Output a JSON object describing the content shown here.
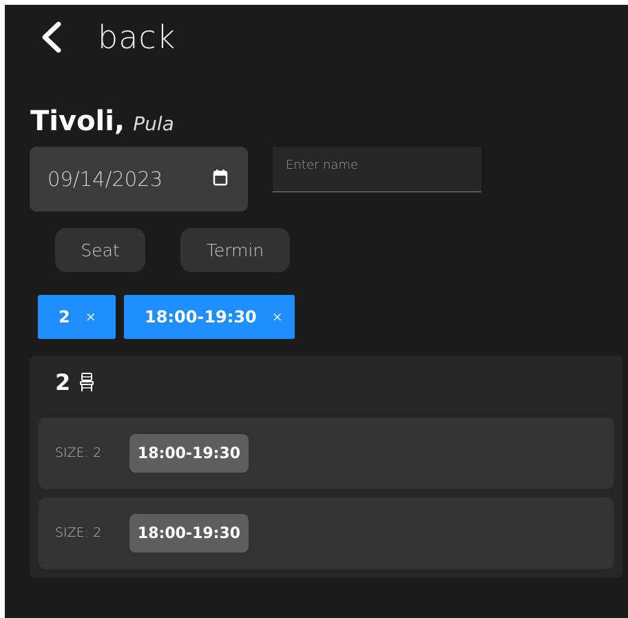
{
  "header": {
    "back_label": "back"
  },
  "venue": {
    "name": "Tivoli",
    "comma": ",",
    "city": "Pula"
  },
  "form": {
    "date_value": "09/14/2023",
    "name_placeholder": "Enter name",
    "name_value": ""
  },
  "filters": {
    "seat_label": "Seat",
    "termin_label": "Termin"
  },
  "active_filters": [
    {
      "label": "2",
      "close": "×"
    },
    {
      "label": "18:00-19:30",
      "close": "×"
    }
  ],
  "results": {
    "seat_count": "2",
    "icons": {
      "back": "chevron-left-icon",
      "calendar": "calendar-icon",
      "seat": "chair-icon"
    },
    "slots": [
      {
        "size_text": "SIZE: 2",
        "time": "18:00-19:30"
      },
      {
        "size_text": "SIZE: 2",
        "time": "18:00-19:30"
      }
    ]
  },
  "colors": {
    "background": "#1b1b1b",
    "chip_accent": "#1f8fff",
    "field_bg": "#3b3b3b",
    "slot_bg": "#333333",
    "time_badge": "#5e5e5e"
  }
}
